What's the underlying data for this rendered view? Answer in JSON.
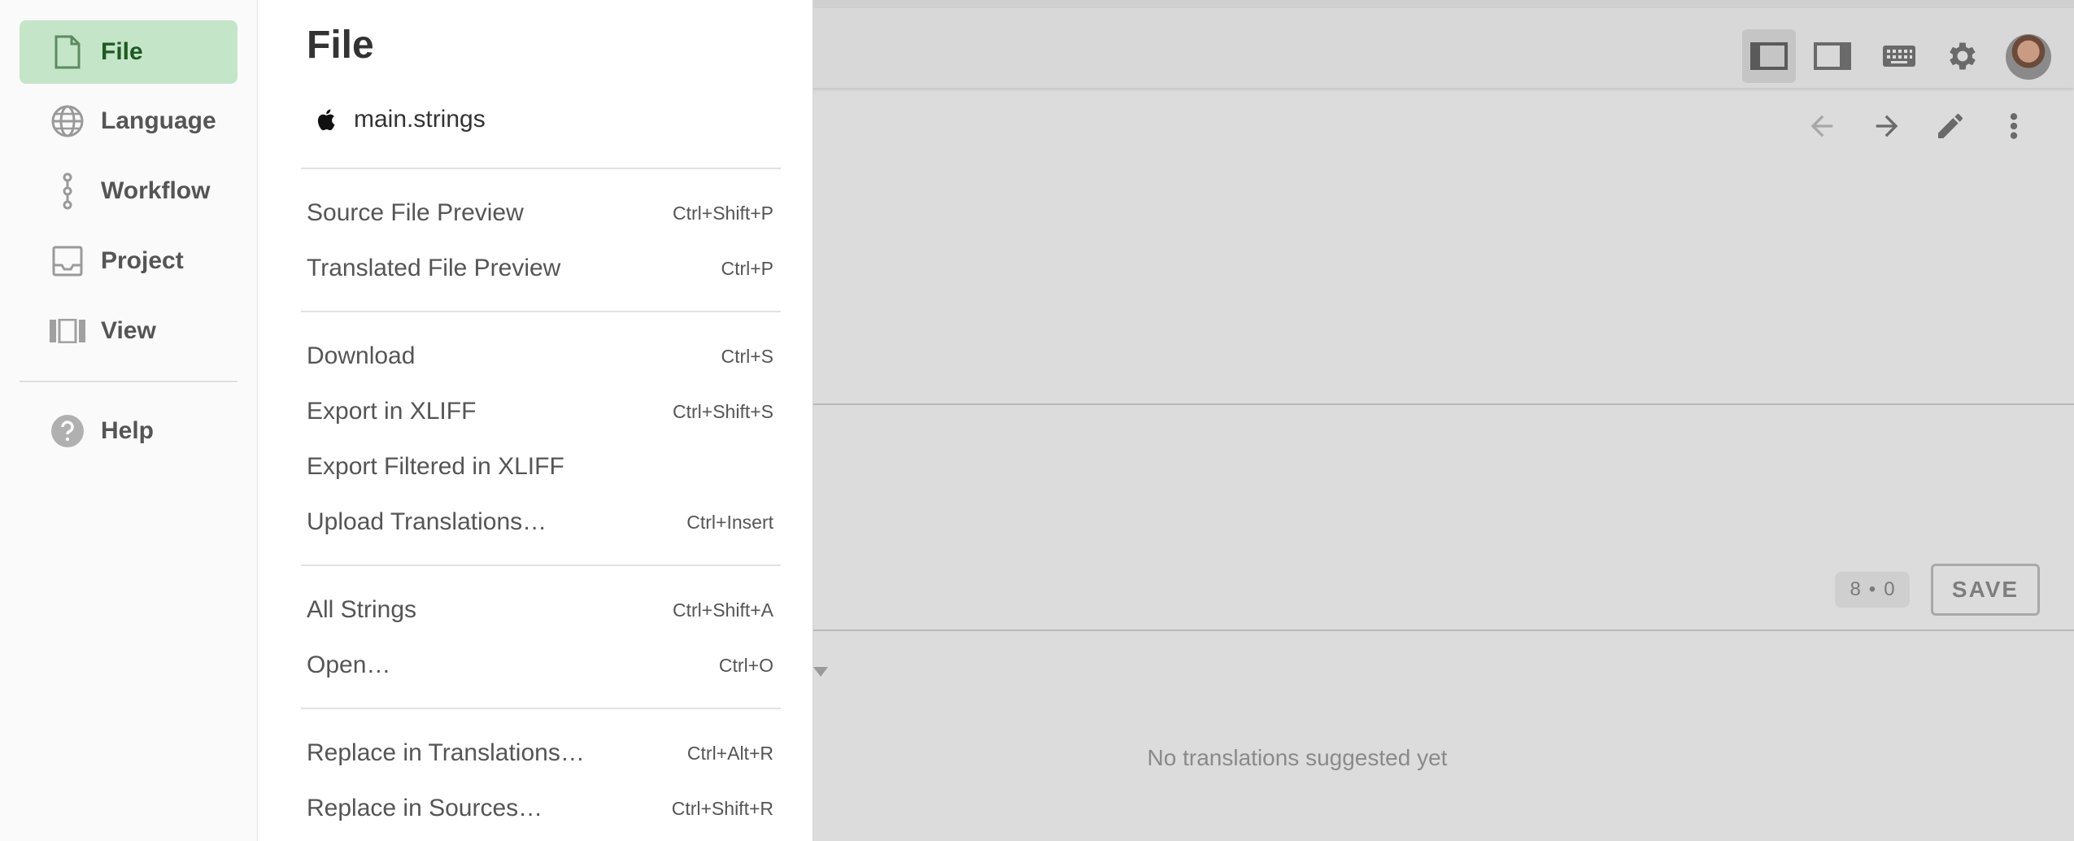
{
  "rail": {
    "items": [
      {
        "label": "File",
        "icon": "file-icon",
        "active": true
      },
      {
        "label": "Language",
        "icon": "globe-icon",
        "active": false
      },
      {
        "label": "Workflow",
        "icon": "workflow-icon",
        "active": false
      },
      {
        "label": "Project",
        "icon": "inbox-icon",
        "active": false
      },
      {
        "label": "View",
        "icon": "view-columns-icon",
        "active": false
      },
      {
        "label": "Help",
        "icon": "help-icon",
        "active": false
      }
    ]
  },
  "panel": {
    "title": "File",
    "file_name": "main.strings",
    "groups": [
      [
        {
          "label": "Source File Preview",
          "shortcut": "Ctrl+Shift+P"
        },
        {
          "label": "Translated File Preview",
          "shortcut": "Ctrl+P"
        }
      ],
      [
        {
          "label": "Download",
          "shortcut": "Ctrl+S"
        },
        {
          "label": "Export in XLIFF",
          "shortcut": "Ctrl+Shift+S"
        },
        {
          "label": "Export Filtered in XLIFF",
          "shortcut": ""
        },
        {
          "label": "Upload Translations…",
          "shortcut": "Ctrl+Insert"
        }
      ],
      [
        {
          "label": "All Strings",
          "shortcut": "Ctrl+Shift+A"
        },
        {
          "label": "Open…",
          "shortcut": "Ctrl+O"
        }
      ],
      [
        {
          "label": "Replace in Translations…",
          "shortcut": "Ctrl+Alt+R"
        },
        {
          "label": "Replace in Sources…",
          "shortcut": "Ctrl+Shift+R"
        }
      ]
    ]
  },
  "background": {
    "counter_left": "8",
    "counter_right": "0",
    "save_label": "SAVE",
    "empty_suggestions": "No translations suggested yet"
  },
  "colors": {
    "accent_active_bg": "#c5e5c8",
    "accent_active_text": "#1f5a23",
    "overlay_bg": "#dcdcdc"
  }
}
